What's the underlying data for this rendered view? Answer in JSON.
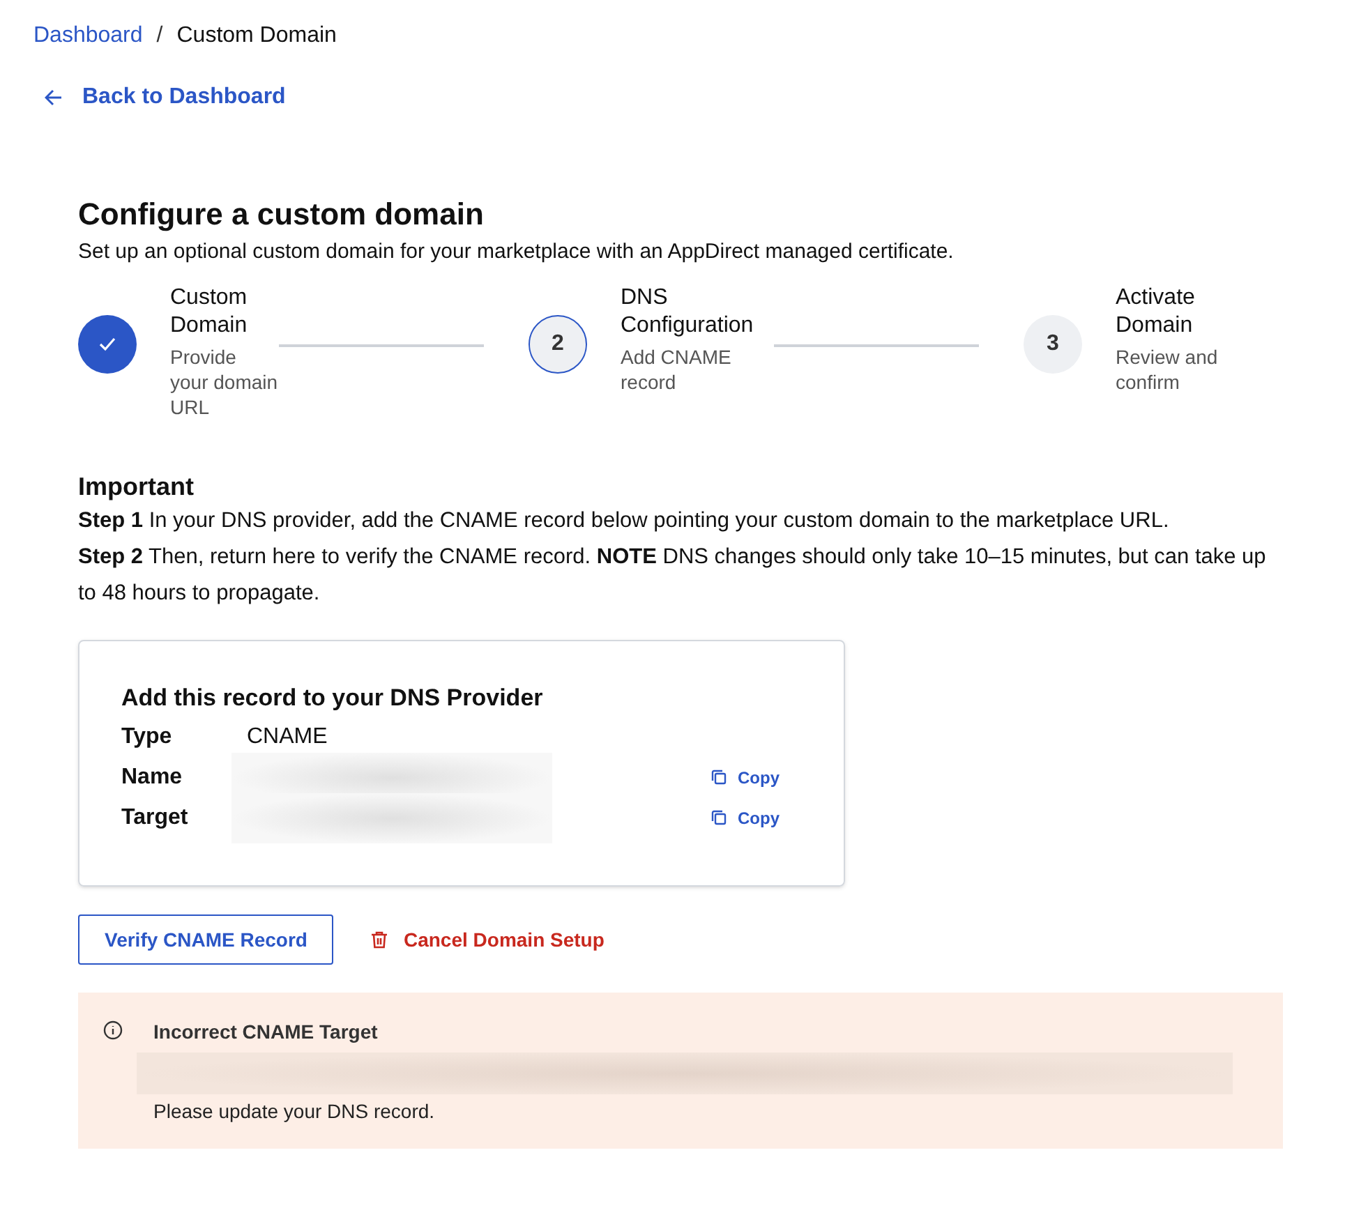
{
  "breadcrumb": [
    {
      "label": "Dashboard",
      "kind": "link"
    },
    {
      "label": "Custom Domain",
      "kind": "current"
    }
  ],
  "back_link": "Back to Dashboard",
  "title": "Configure a custom domain",
  "subtitle": "Set up an optional custom domain for your marketplace with an AppDirect managed certificate.",
  "breadcrumb_separator": "/",
  "steps": [
    {
      "title": "Custom Domain",
      "description": "Provide your domain URL",
      "completed": true,
      "current": false
    },
    {
      "number": "2",
      "title": "DNS Configuration",
      "description": "Add CNAME record",
      "completed": false,
      "current": true
    },
    {
      "number": "3",
      "title": "Activate Domain",
      "description": "Review and confirm",
      "completed": false,
      "current": false
    }
  ],
  "important": {
    "heading": "Important",
    "lines": [
      "**Step 1** In your DNS provider, add the CNAME record below pointing your custom domain to the marketplace URL.",
      "**Step 2** Then, return here to verify the CNAME record. **NOTE** DNS changes should only take 10–15 minutes, but can take up to 48 hours to propagate."
    ]
  },
  "record_card": {
    "title": "Add this record to your DNS Provider",
    "rows": [
      {
        "label": "Type",
        "value": "CNAME",
        "kind": "plain"
      },
      {
        "label": "Name",
        "kind": "redacted",
        "copy": "Copy"
      },
      {
        "label": "Target",
        "kind": "redacted",
        "copy": "Copy"
      }
    ]
  },
  "verify_button": "Verify CNAME Record",
  "cancel_button": "Cancel Domain Setup",
  "alert": {
    "title": "Incorrect CNAME Target",
    "message": "Please update your DNS record."
  }
}
